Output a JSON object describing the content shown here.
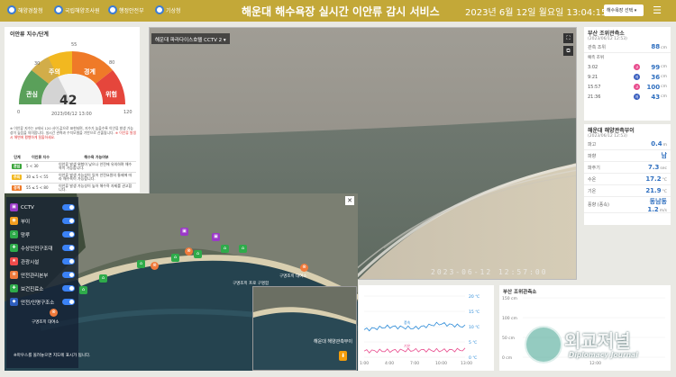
{
  "header": {
    "logos": [
      "해양경찰청",
      "국립해양조사원",
      "행정안전부",
      "기상청"
    ],
    "title": "해운대 해수욕장 실시간 이안류 감시 서비스",
    "datetime": "2023년 6월 12일 월요일  13:04:15",
    "beach_select": "해수욕장 선택",
    "colors": {
      "bar": "#c3a838"
    }
  },
  "rip_index": {
    "title": "이안류 지수/단계",
    "value": "42",
    "time": "2023/06/12 13:00",
    "ticks": [
      "30",
      "55",
      "80",
      "120",
      "0"
    ],
    "levels_on_gauge": [
      "관심",
      "주의",
      "경계",
      "위험"
    ],
    "gauge_fill": 0.35,
    "colors": {
      "관심": "#3aa53a",
      "주의": "#f2b820",
      "경계": "#ef7a28",
      "위험": "#e5463c"
    },
    "note": "※ 이안류 지수는 0에서 120 사이 값으로 표현되며, 지수가 높을수록 이안류 발생 가능성이 높음을 의미합니다. 실시간 관측과 수치모델을 기반으로 산출됩니다.",
    "note_red": "※ 이안류 발생 시 해변에 평행하게 탈출하세요."
  },
  "level_table": {
    "headers": [
      "단계",
      "이안류 지수",
      "해수욕 가능여부"
    ],
    "rows": [
      {
        "level": "관심",
        "range": "5 < 30",
        "desc": "이안류 발생 위험이 낮으나 안전에 유의하며 해수욕이 가능합니다."
      },
      {
        "level": "주의",
        "range": "30 ≤ 5 < 55",
        "desc": "이안류 발생 가능성이 있어 안전요원의 통제에 따라 해수욕이 가능합니다."
      },
      {
        "level": "경계",
        "range": "55 ≤ 5 < 80",
        "desc": "이안류 발생 가능성이 높아 해수욕 자제를 권고합니다."
      },
      {
        "level": "위험",
        "range": "80 ≤ 5 < 120",
        "desc": "이안류 발생 위험이 매우 높아 해수욕을 금지합니다."
      }
    ]
  },
  "cctv": {
    "camera_label": "해운대 파라다이스호텔 CCTV 2",
    "timestamp": "2023-06-12 12:57:00"
  },
  "tide": {
    "title": "부산 조위관측소",
    "date": "(2023/06/12 12:53)",
    "current_label": "관측 조위",
    "current_value": "88",
    "unit": "cm",
    "forecast_label": "예측 조위",
    "rows": [
      {
        "time": "3:02",
        "type": "고",
        "value": "99"
      },
      {
        "time": "9:21",
        "type": "저",
        "value": "36"
      },
      {
        "time": "15:57",
        "type": "고",
        "value": "100"
      },
      {
        "time": "21:36",
        "type": "저",
        "value": "43"
      }
    ],
    "colors": {
      "고": "#e84a8c",
      "저": "#3b5fbf"
    }
  },
  "buoy": {
    "title": "해운대 해양관측부이",
    "date": "(2023/06/12 12:53)",
    "rows": [
      {
        "label": "파고",
        "value": "0.4",
        "unit": "m"
      },
      {
        "label": "파향",
        "value": "남",
        "unit": ""
      },
      {
        "label": "파주기",
        "value": "7.3",
        "unit": "sec"
      },
      {
        "label": "수온",
        "value": "17.2",
        "unit": "°C"
      },
      {
        "label": "기온",
        "value": "21.9",
        "unit": "°C"
      },
      {
        "label": "풍향 (풍속)",
        "value": "동남동",
        "value2": "1.2",
        "unit": "m/s"
      }
    ]
  },
  "map": {
    "legend": [
      {
        "label": "CCTV",
        "color": "#9b39c8",
        "icon": "cctv-icon"
      },
      {
        "label": "부이",
        "color": "#f29d1e",
        "icon": "buoy-icon"
      },
      {
        "label": "망루",
        "color": "#2eab4a",
        "icon": "tower-icon"
      },
      {
        "label": "수상안전구조대",
        "color": "#2eab4a",
        "icon": "rescue-icon"
      },
      {
        "label": "관광시설",
        "color": "#ef4b4b",
        "icon": "tourism-icon"
      },
      {
        "label": "안전관리본부",
        "color": "#f07a3b",
        "icon": "hq-icon"
      },
      {
        "label": "보건진료소",
        "color": "#2e5fbf",
        "icon": "clinic-icon"
      },
      {
        "label": "안전/인명구조소",
        "color": "#2e5fbf",
        "icon": "lifesaving-icon"
      }
    ],
    "labels": [
      "구명조끼 대여소",
      "구명조끼 프로 구명함",
      "구명조끼 대여소"
    ],
    "note": "※마우스를 올려놓으면 지도에 표시가 됩니다.",
    "inset_label": "해운대 해양관측부이"
  },
  "chart_data": [
    {
      "type": "line",
      "title": "",
      "x": [
        "1:00",
        "4:00",
        "7:00",
        "10:00",
        "13:00"
      ],
      "yticks_right": [
        "20 ℃",
        "15 ℃",
        "10 ℃",
        "5 ℃",
        "0 ℃"
      ],
      "series": [
        {
          "name": "풍속",
          "color": "#2a8ad8",
          "values": [
            9,
            10,
            9.5,
            11,
            10
          ]
        },
        {
          "name": "기온",
          "color": "#e84a8c",
          "values": [
            2,
            2.1,
            2.3,
            2.2,
            2.4
          ]
        }
      ]
    },
    {
      "type": "line",
      "title": "부산 조위관측소",
      "yticks": [
        "150 cm",
        "100 cm",
        "50 cm",
        "0 cm"
      ],
      "x": [
        "12:00"
      ]
    }
  ]
}
